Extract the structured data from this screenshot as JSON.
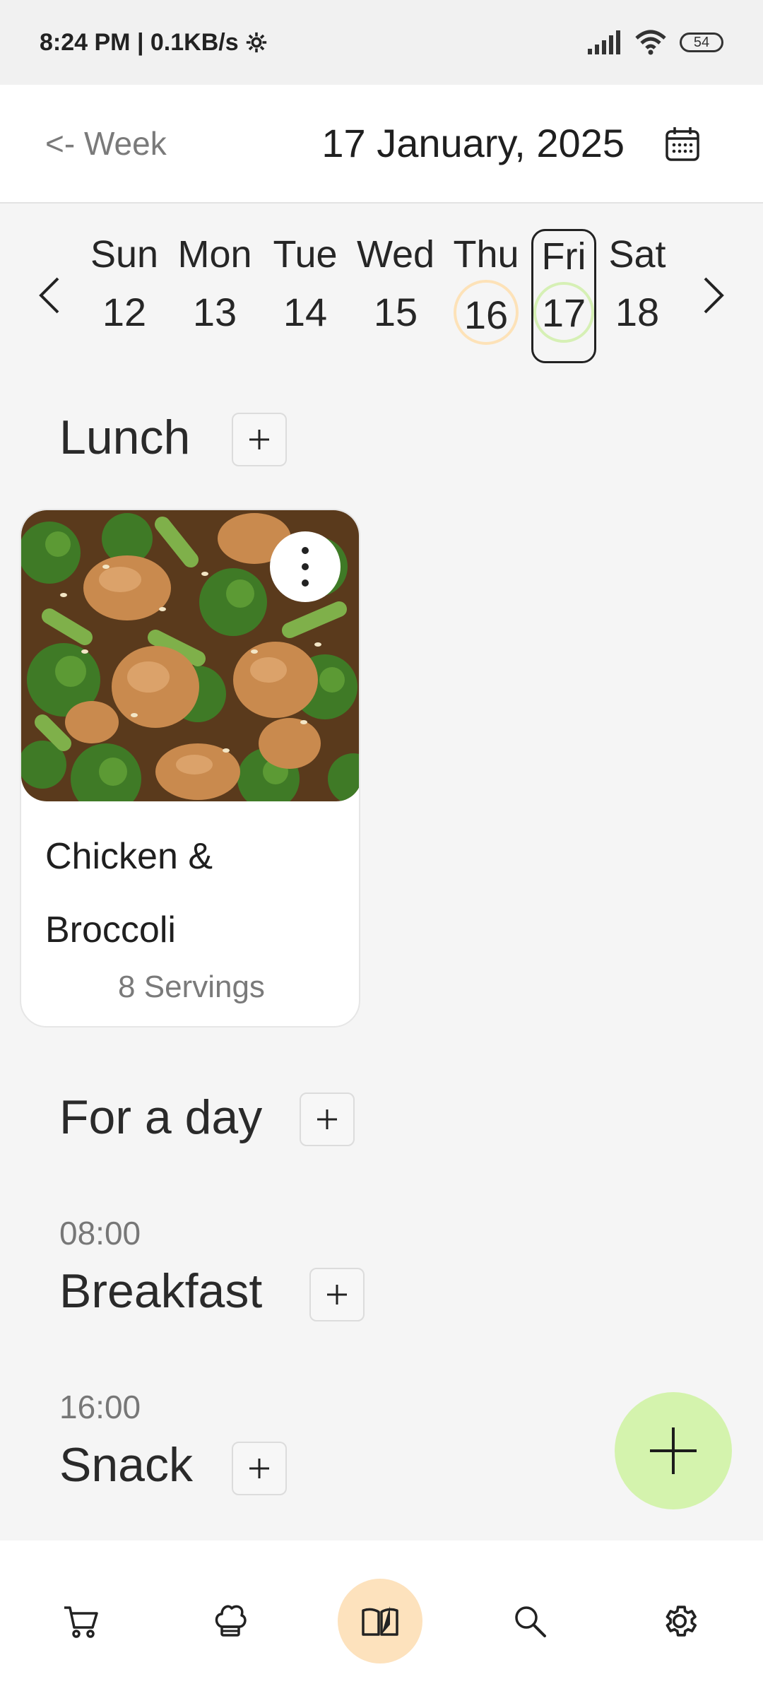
{
  "status_bar": {
    "time_speed": "8:24 PM | 0.1KB/s",
    "battery": "54"
  },
  "header": {
    "back_label": "<- Week",
    "date_title": "17 January, 2025"
  },
  "week": {
    "days": [
      {
        "name": "Sun",
        "num": "12"
      },
      {
        "name": "Mon",
        "num": "13"
      },
      {
        "name": "Tue",
        "num": "14"
      },
      {
        "name": "Wed",
        "num": "15"
      },
      {
        "name": "Thu",
        "num": "16"
      },
      {
        "name": "Fri",
        "num": "17"
      },
      {
        "name": "Sat",
        "num": "18"
      }
    ],
    "today": "16",
    "selected": "17"
  },
  "sections": {
    "lunch": {
      "title": "Lunch",
      "add": "+"
    },
    "for_a_day": {
      "title": "For a day",
      "add": "+"
    },
    "breakfast": {
      "time": "08:00",
      "title": "Breakfast",
      "add": "+"
    },
    "snack": {
      "time": "16:00",
      "title": "Snack",
      "add": "+"
    }
  },
  "recipe": {
    "title": "Chicken & Broccoli",
    "servings": "8 Servings"
  },
  "bottom_nav": {
    "items": [
      "cart-icon",
      "chef-hat-icon",
      "book-icon",
      "search-icon",
      "gear-icon"
    ],
    "active": "book-icon"
  },
  "colors": {
    "accent_green": "#d4f3ad",
    "accent_orange": "#fde2bd",
    "background": "#f5f5f5"
  }
}
